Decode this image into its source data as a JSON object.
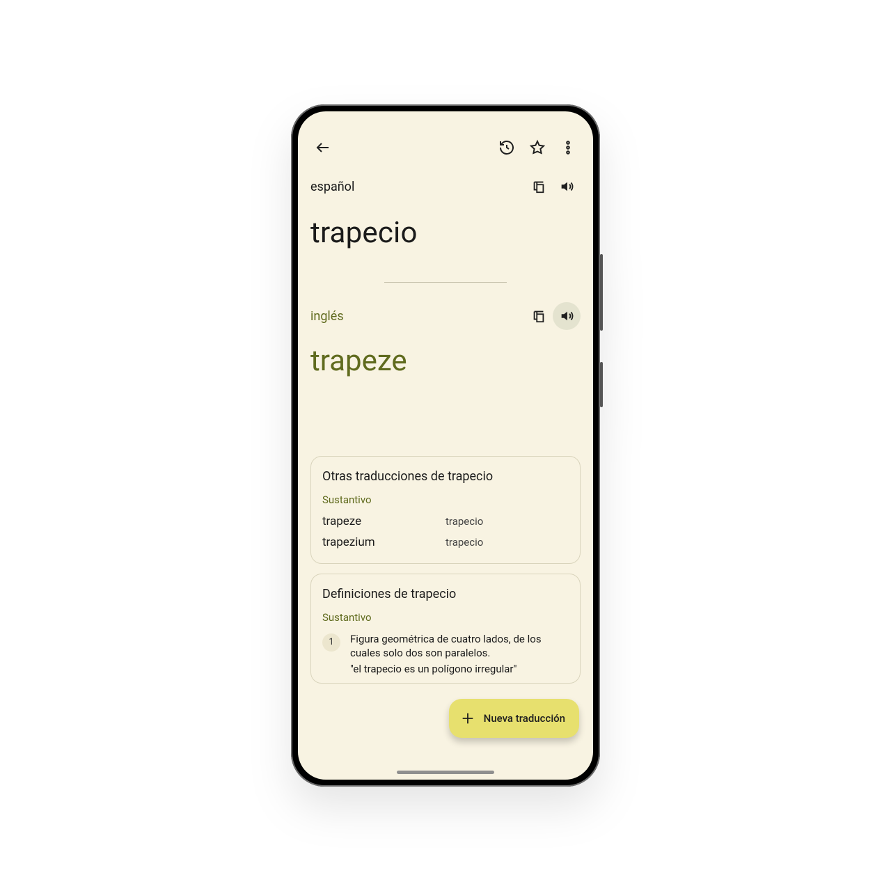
{
  "source": {
    "lang": "español",
    "text": "trapecio"
  },
  "target": {
    "lang": "inglés",
    "text": "trapeze"
  },
  "others": {
    "title": "Otras traducciones de trapecio",
    "pos": "Sustantivo",
    "rows": [
      {
        "a": "trapeze",
        "b": "trapecio"
      },
      {
        "a": "trapezium",
        "b": "trapecio"
      }
    ]
  },
  "defs": {
    "title": "Definiciones de trapecio",
    "pos": "Sustantivo",
    "items": [
      {
        "n": "1",
        "text": "Figura geométrica de cuatro lados, de los cuales solo dos son paralelos.",
        "example": "\"el trapecio es un polígono irregular\""
      }
    ]
  },
  "fab": {
    "label": "Nueva traducción"
  }
}
